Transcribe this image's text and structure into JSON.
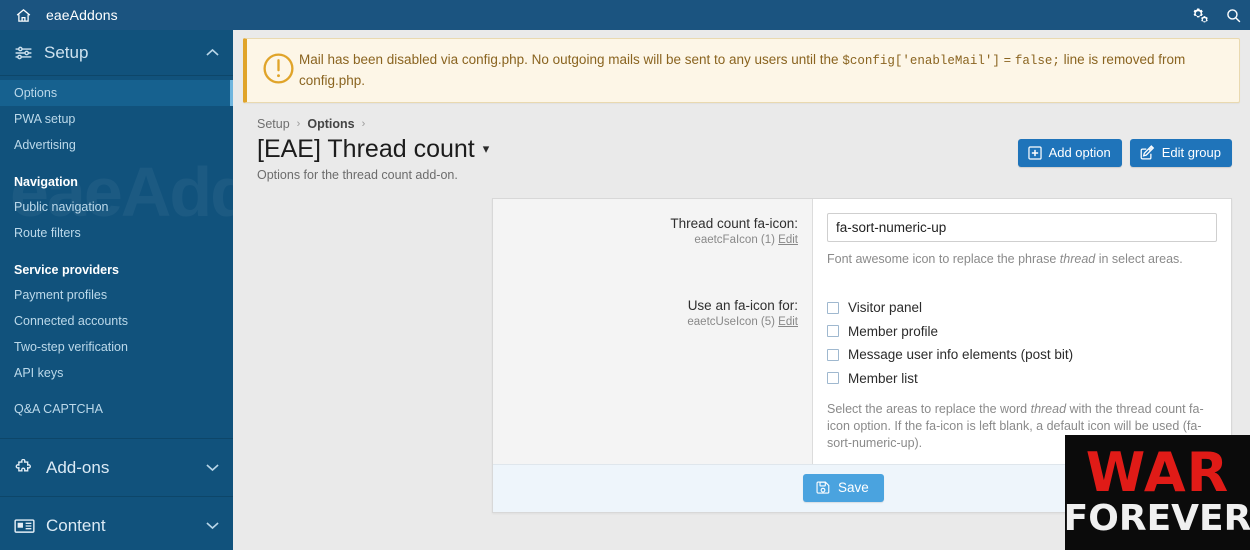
{
  "topbar": {
    "home_icon": "home-icon",
    "brand": "eaeAddons",
    "cogs_icon": "cogs-icon",
    "search_icon": "search-icon"
  },
  "sidebar": {
    "watermark": "eaeAddons",
    "setup": {
      "label": "Setup",
      "icon": "sliders-icon",
      "caret": "⌃"
    },
    "items": [
      {
        "label": "Options",
        "active": true
      },
      {
        "label": "PWA setup",
        "active": false
      },
      {
        "label": "Advertising",
        "active": false
      }
    ],
    "groups": [
      {
        "title": "Navigation",
        "items": [
          {
            "label": "Public navigation"
          },
          {
            "label": "Route filters"
          }
        ]
      },
      {
        "title": "Service providers",
        "items": [
          {
            "label": "Payment profiles"
          },
          {
            "label": "Connected accounts"
          },
          {
            "label": "Two-step verification"
          },
          {
            "label": "API keys"
          }
        ]
      }
    ],
    "extra_items": [
      {
        "label": "Q&A CAPTCHA"
      }
    ],
    "sections": [
      {
        "label": "Add-ons",
        "icon": "puzzle-piece-icon",
        "caret": "⌄"
      },
      {
        "label": "Content",
        "icon": "newspaper-icon",
        "caret": "⌄"
      }
    ]
  },
  "notice": {
    "icon": "exclamation-circle-icon",
    "text_part1": "Mail has been disabled via config.php. No outgoing mails will be sent to any users until the ",
    "code1": "$config['enableMail']",
    "code2": "=",
    "code3": "false;",
    "text_part2": " line is removed from config.php."
  },
  "breadcrumb": {
    "items": [
      "Setup",
      "Options"
    ],
    "separator": "›"
  },
  "page": {
    "title": "[EAE] Thread count",
    "title_caret": "▾",
    "subtitle": "Options for the thread count add-on."
  },
  "actions": {
    "add_option": {
      "label": "Add option",
      "icon": "plus-square-icon"
    },
    "edit_group": {
      "label": "Edit group",
      "icon": "edit-pencil-icon"
    }
  },
  "form": {
    "rows": [
      {
        "label": "Thread count fa-icon:",
        "sublabel_name": "eaetcFaIcon (1)",
        "sublabel_link": "Edit",
        "input_value": "fa-sort-numeric-up",
        "input_placeholder": "",
        "explain_pre": "Font awesome icon to replace the phrase ",
        "explain_em": "thread",
        "explain_post": " in select areas."
      },
      {
        "label": "Use an fa-icon for:",
        "sublabel_name": "eaetcUseIcon (5)",
        "sublabel_link": "Edit",
        "checkboxes": [
          {
            "label": "Visitor panel",
            "checked": false
          },
          {
            "label": "Member profile",
            "checked": false
          },
          {
            "label": "Message user info elements (post bit)",
            "checked": false
          },
          {
            "label": "Member list",
            "checked": false
          }
        ],
        "explain_pre": "Select the areas to replace the word ",
        "explain_em": "thread",
        "explain_post": " with the thread count fa-icon option. If the fa-icon is left blank, a default icon will be used (fa-sort-numeric-up)."
      }
    ],
    "save": {
      "label": "Save",
      "icon": "floppy-save-icon"
    }
  },
  "overlay": {
    "line1": "WAR",
    "line2": "FOREVER"
  },
  "colors": {
    "topbar": "#1b5480",
    "sidebar": "#11527c",
    "sidebar_active": "#16618f",
    "accent_button": "#1f74ba",
    "save_button": "#4aa3df",
    "notice_bg": "#fdf6e7",
    "notice_border": "#e0a42a",
    "notice_text": "#8a6420",
    "page_bg": "#eaeaea",
    "overlay_red": "#e01b17"
  }
}
